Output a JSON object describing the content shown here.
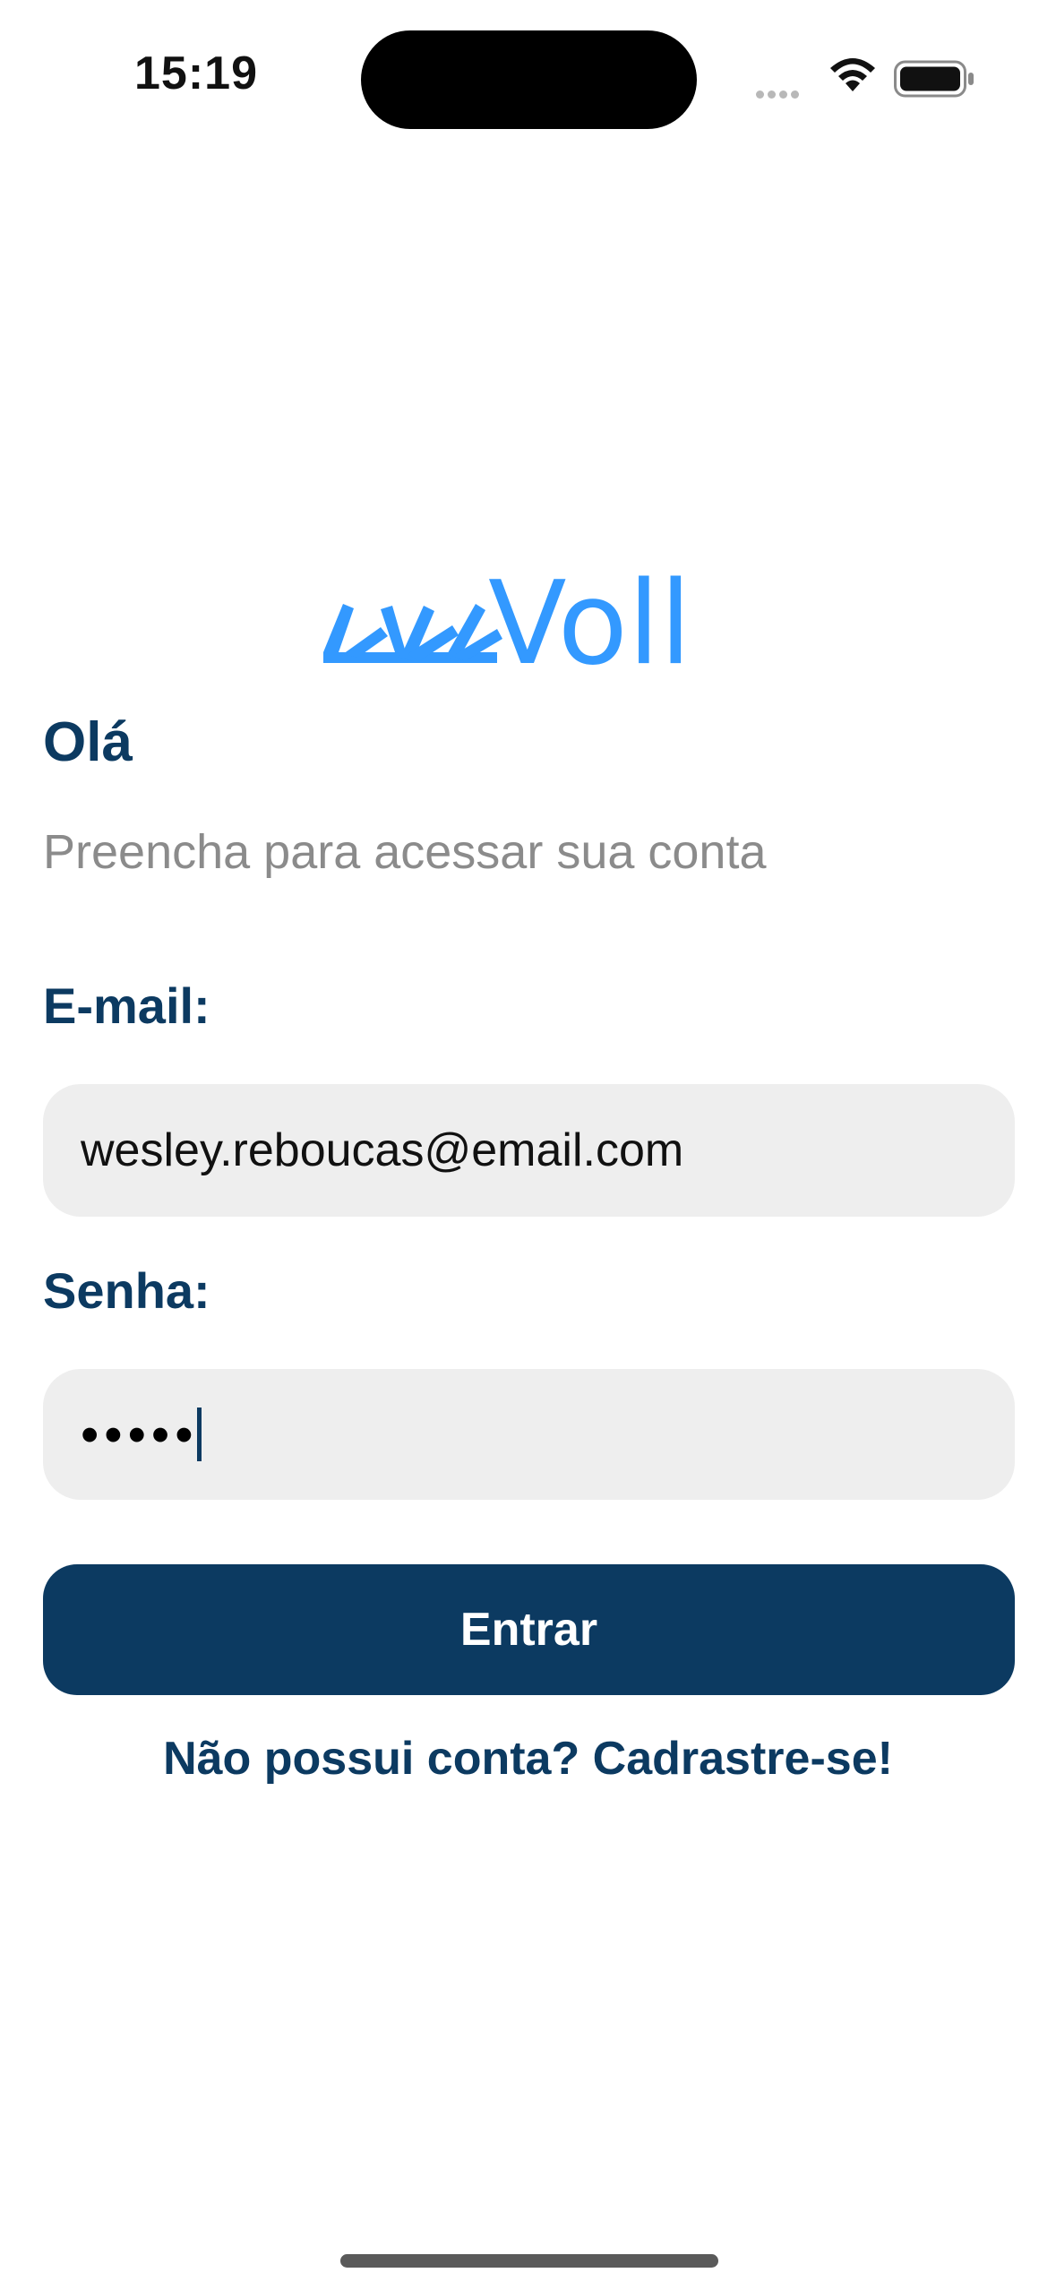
{
  "status_bar": {
    "time": "15:19",
    "cellular_icon": "cellular-signal-icon",
    "wifi_icon": "wifi-icon",
    "battery_icon": "battery-icon"
  },
  "logo": {
    "text": "Voll",
    "color": "#3399ff"
  },
  "login": {
    "greeting": "Olá",
    "subtitle": "Preencha para acessar sua conta",
    "email_label": "E-mail:",
    "email_value": "wesley.reboucas@email.com",
    "password_label": "Senha:",
    "password_value": "•••••",
    "submit_label": "Entrar",
    "signup_link": "Não possui conta? Cadrastre-se!"
  },
  "colors": {
    "primary": "#0c3a61",
    "logo_blue": "#3399ff",
    "input_background": "#eeeeee",
    "subtitle": "#8b8b8b"
  }
}
